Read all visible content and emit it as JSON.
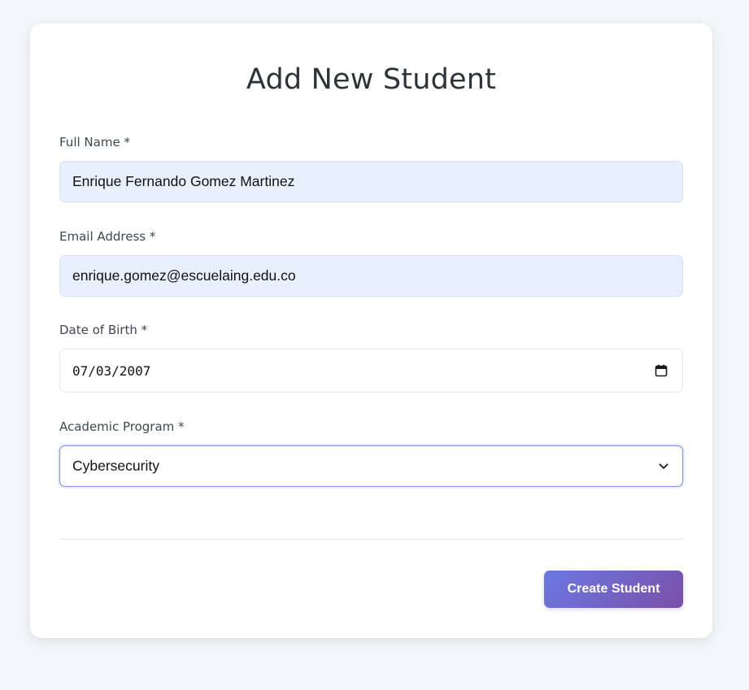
{
  "form": {
    "title": "Add New Student",
    "fields": {
      "full_name": {
        "label": "Full Name *",
        "value": "Enrique Fernando Gomez Martinez"
      },
      "email": {
        "label": "Email Address *",
        "value": "enrique.gomez@escuelaing.edu.co"
      },
      "dob": {
        "label": "Date of Birth *",
        "value": "07/03/2007",
        "icon": "calendar-icon"
      },
      "program": {
        "label": "Academic Program *",
        "value": "Cybersecurity",
        "icon": "chevron-down-icon"
      }
    },
    "submit_label": "Create Student"
  },
  "colors": {
    "page_background": "#f4f7fa",
    "autofill_background": "#e8f0fe",
    "focus_border": "#7f8ff4",
    "button_gradient_start": "#6b79e3",
    "button_gradient_end": "#7a4fa8"
  }
}
